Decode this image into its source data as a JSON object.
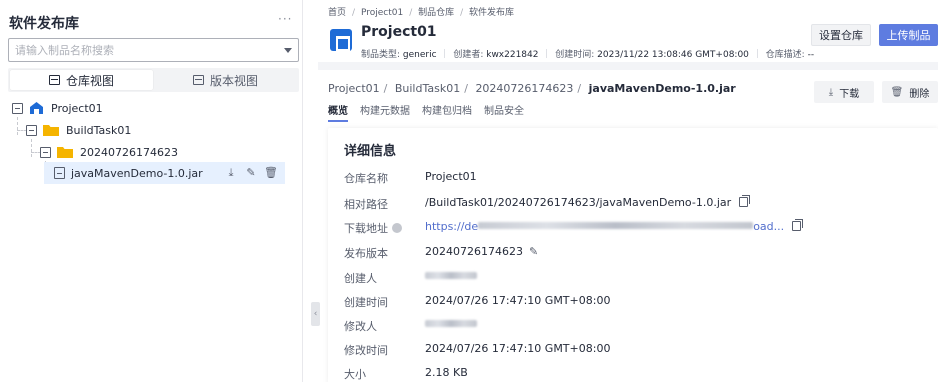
{
  "sidebar": {
    "title": "软件发布库",
    "more": "···",
    "search_placeholder": "请输入制品名称搜索",
    "views": [
      "仓库视图",
      "版本视图"
    ],
    "tree": {
      "root": "Project01",
      "level1": "BuildTask01",
      "level2": "20240726174623",
      "file": "javaMavenDemo-1.0.jar"
    }
  },
  "header": {
    "breadcrumb": [
      "首页",
      "Project01",
      "制品仓库",
      "软件发布库"
    ],
    "project_name": "Project01",
    "meta": {
      "type_label": "制品类型:",
      "type_value": "generic",
      "creator_label": "创建者:",
      "creator_value": "kwx221842",
      "created_label": "创建时间:",
      "created_value": "2023/11/22 13:08:46 GMT+08:00",
      "desc_label": "仓库描述:",
      "desc_value": "--"
    },
    "buttons": {
      "setup": "设置仓库",
      "upload": "上传制品"
    }
  },
  "content": {
    "path": [
      "Project01",
      "BuildTask01",
      "20240726174623",
      "javaMavenDemo-1.0.jar"
    ],
    "actions": {
      "download": "下载",
      "delete": "删除"
    },
    "tabs": [
      "概览",
      "构建元数据",
      "构建包归档",
      "制品安全"
    ],
    "card": {
      "title": "详细信息",
      "rows": [
        {
          "label": "仓库名称",
          "value": "Project01"
        },
        {
          "label": "相对路径",
          "value": "/BuildTask01/20240726174623/javaMavenDemo-1.0.jar"
        },
        {
          "label": "下载地址",
          "value_prefix": "https://de",
          "value_suffix": "oad..."
        },
        {
          "label": "发布版本",
          "value": "20240726174623"
        },
        {
          "label": "创建人",
          "value": ""
        },
        {
          "label": "创建时间",
          "value": "2024/07/26 17:47:10 GMT+08:00"
        },
        {
          "label": "修改人",
          "value": ""
        },
        {
          "label": "修改时间",
          "value": "2024/07/26 17:47:10 GMT+08:00"
        },
        {
          "label": "大小",
          "value": "2.18 KB"
        }
      ]
    }
  },
  "colors": {
    "accent": "#5e7ce0",
    "highlight": "#e0252a",
    "link": "#526ecc",
    "folder": "#f5b400",
    "selected_row": "#e6f0fe"
  }
}
